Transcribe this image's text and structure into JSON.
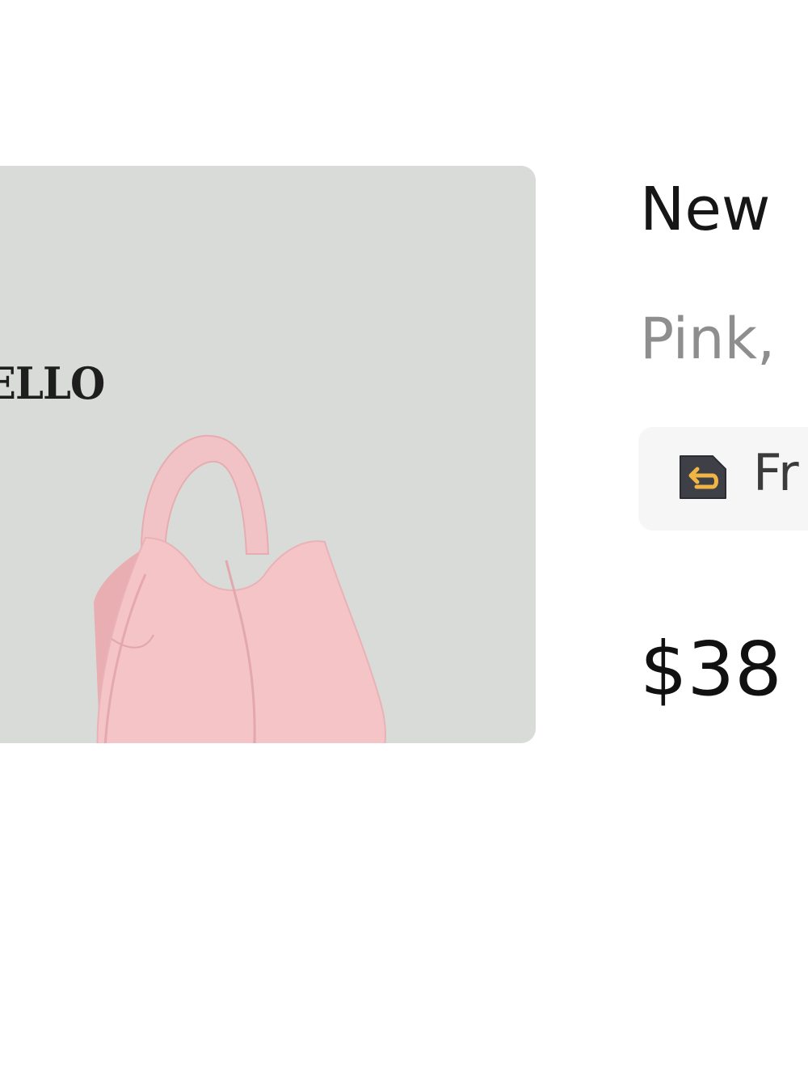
{
  "product": {
    "brand_logo": "ELLO",
    "title": "New",
    "variant": "Pink,",
    "return_badge": "Fr",
    "price": "$38",
    "image_icon": "handbag-image",
    "return_icon": "return-arrow-icon"
  },
  "colors": {
    "image_background": "#d9dbd8",
    "bag_pink": "#f1c0c4",
    "title_text": "#161616",
    "variant_text": "#8e8e8e",
    "badge_background": "#f6f6f6",
    "badge_icon_background": "#3f3f47",
    "badge_icon_arrow": "#f0b544"
  }
}
